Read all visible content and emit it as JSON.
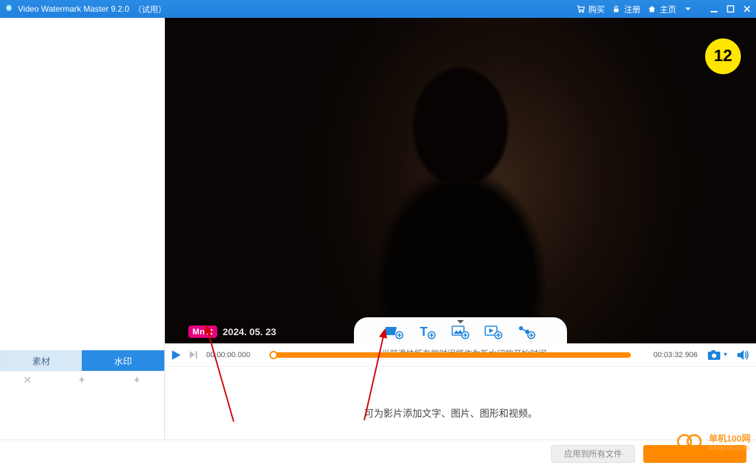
{
  "title": {
    "app_name": "Video Watermark Master 9.2.0",
    "suffix": "（试用）",
    "buy": "购买",
    "register": "注册",
    "home": "主页"
  },
  "sidebar": {
    "tab_material": "素材",
    "tab_watermark": "水印"
  },
  "preview": {
    "rating": "12",
    "channel": "Mnet",
    "broadcast_date": "2024. 05. 23"
  },
  "playback": {
    "current_time": "00:00:00.000",
    "total_time": "00:03:32.906"
  },
  "hints": {
    "slider_hint": "当前滑块所在的时间将作为新水印的开始时间。",
    "description": "可为影片添加文字、图片、图形和视频。"
  },
  "bottom": {
    "apply_all": "应用到所有文件"
  },
  "site_watermark": {
    "name": "单机100网",
    "url": "danji100.com"
  }
}
